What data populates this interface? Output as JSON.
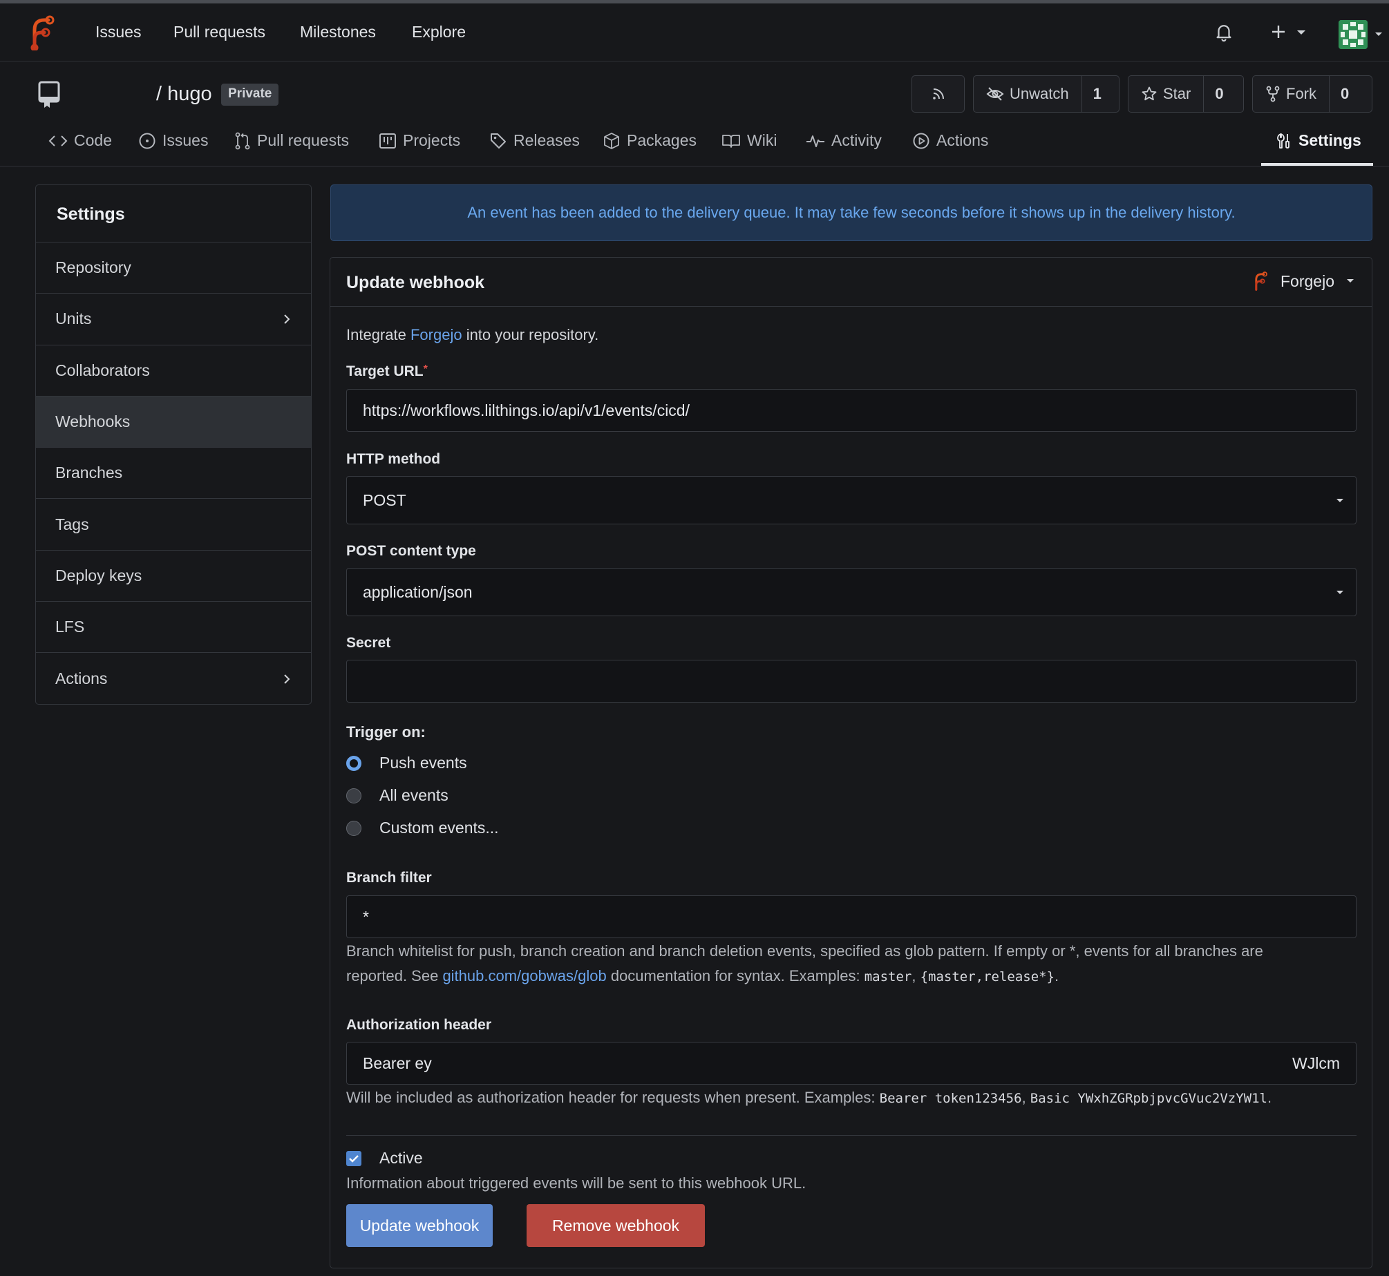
{
  "nav": {
    "links": [
      "Issues",
      "Pull requests",
      "Milestones",
      "Explore"
    ]
  },
  "repo": {
    "name": "/ hugo",
    "badge": "Private",
    "unwatch_label": "Unwatch",
    "unwatch_count": "1",
    "star_label": "Star",
    "star_count": "0",
    "fork_label": "Fork",
    "fork_count": "0"
  },
  "tabs": {
    "code": "Code",
    "issues": "Issues",
    "pulls": "Pull requests",
    "projects": "Projects",
    "releases": "Releases",
    "packages": "Packages",
    "wiki": "Wiki",
    "activity": "Activity",
    "actions": "Actions",
    "settings": "Settings"
  },
  "sidebar": {
    "title": "Settings",
    "items": [
      {
        "label": "Repository"
      },
      {
        "label": "Units"
      },
      {
        "label": "Collaborators"
      },
      {
        "label": "Webhooks"
      },
      {
        "label": "Branches"
      },
      {
        "label": "Tags"
      },
      {
        "label": "Deploy keys"
      },
      {
        "label": "LFS"
      },
      {
        "label": "Actions"
      }
    ]
  },
  "flash": {
    "message": "An event has been added to the delivery queue. It may take few seconds before it shows up in the delivery history."
  },
  "form": {
    "title": "Update webhook",
    "type_label": "Forgejo",
    "intro_prefix": "Integrate",
    "intro_link": "Forgejo",
    "intro_suffix": "into your repository.",
    "target_url_label": "Target URL",
    "target_url_value": "https://workflows.lilthings.io/api/v1/events/cicd/",
    "http_method_label": "HTTP method",
    "http_method_value": "POST",
    "content_type_label": "POST content type",
    "content_type_value": "application/json",
    "secret_label": "Secret",
    "secret_value": "",
    "trigger_label": "Trigger on:",
    "triggers": {
      "push": "Push events",
      "all": "All events",
      "custom": "Custom events..."
    },
    "branch_filter_label": "Branch filter",
    "branch_filter_value": "*",
    "branch_help_1": "Branch whitelist for push, branch creation and branch deletion events, specified as glob pattern. If empty or",
    "branch_help_star": "*",
    "branch_help_2": ", events for all branches are",
    "branch_help_3": "reported. See",
    "branch_help_link": "github.com/gobwas/glob",
    "branch_help_4": "documentation for syntax. Examples:",
    "branch_help_ex1": "master",
    "branch_help_ex2": "{master,release*}",
    "auth_label": "Authorization header",
    "auth_value_left": "Bearer ey",
    "auth_value_right": "WJlcm",
    "auth_help_1": "Will be included as authorization header for requests when present. Examples:",
    "auth_help_ex1": "Bearer token123456",
    "auth_help_ex2": "Basic YWxhZGRpbjpvcGVuc2VzYW1l",
    "active_label": "Active",
    "active_help": "Information about triggered events will be sent to this webhook URL.",
    "update_button": "Update webhook",
    "remove_button": "Remove webhook"
  },
  "colors": {
    "accent": "#5d87cc",
    "danger": "#b7473f",
    "link": "#6aa3ea",
    "brand_orange": "#e0521e"
  }
}
